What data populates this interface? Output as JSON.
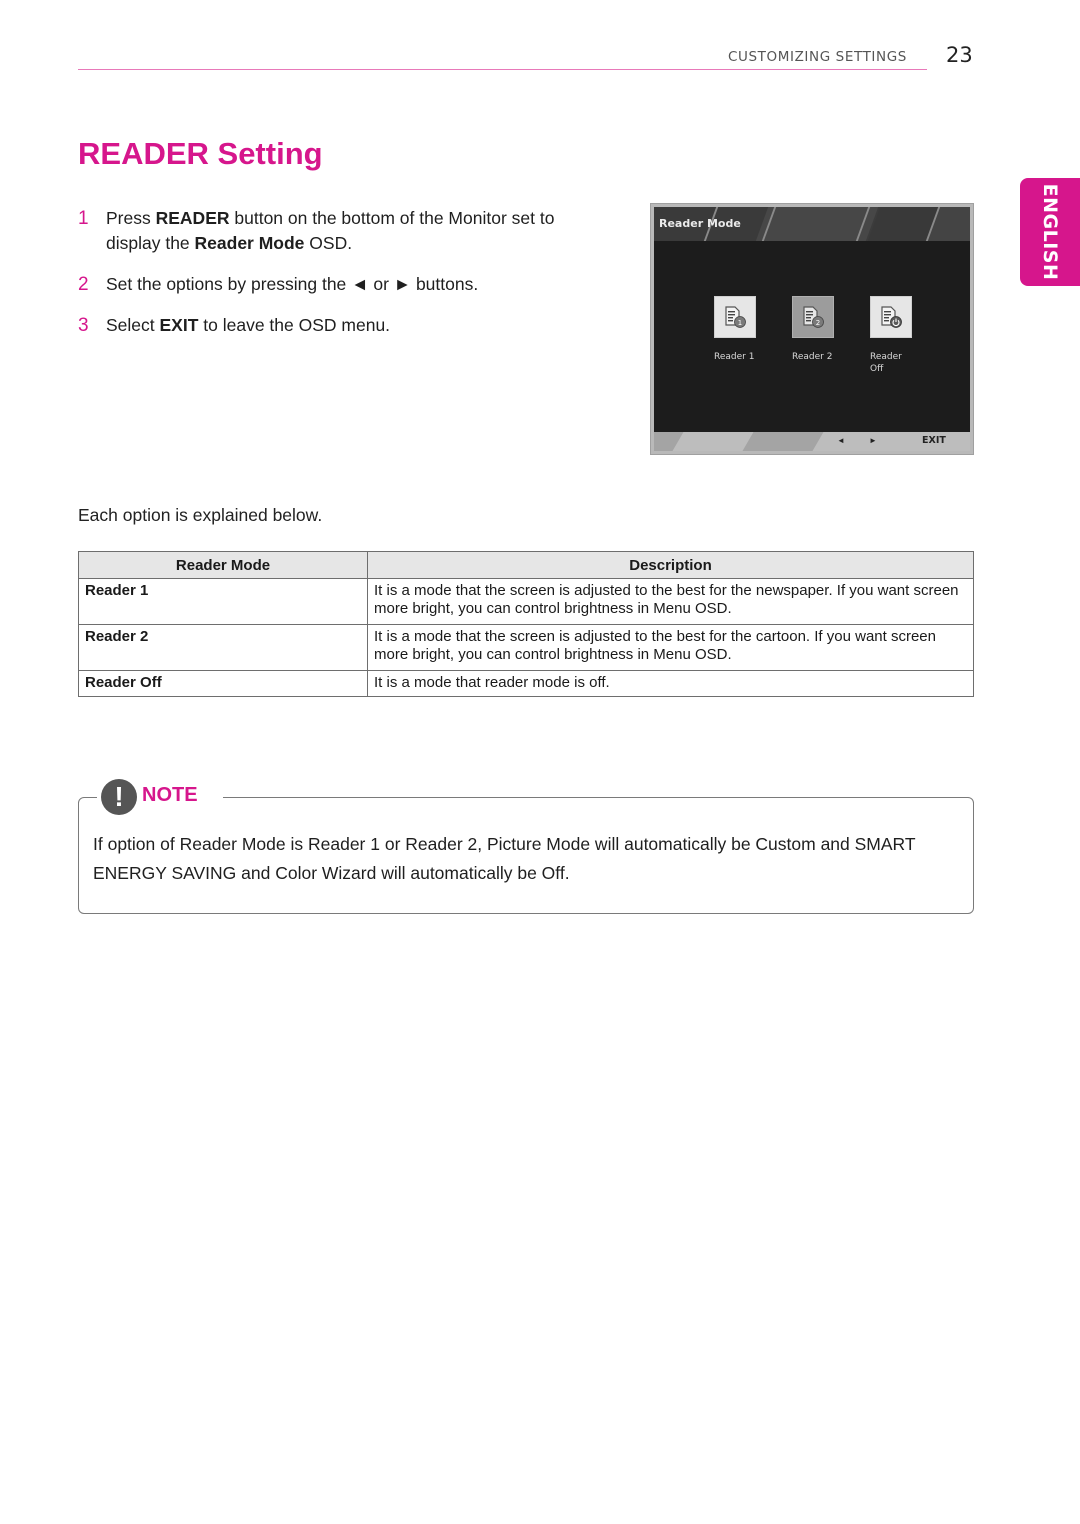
{
  "header": {
    "section_title": "CUSTOMIZING SETTINGS",
    "page_number": "23"
  },
  "language_tab": "ENGLISH",
  "title": "READER Setting",
  "steps": [
    {
      "num": "1",
      "pre": "Press ",
      "bold1": "READER",
      "mid": " button on the bottom of the Monitor set to display the ",
      "bold2": "Reader Mode",
      "post": " OSD."
    },
    {
      "num": "2",
      "text": "Set the options by pressing the ◄ or ► buttons."
    },
    {
      "num": "3",
      "pre": "Select ",
      "bold1": "EXIT",
      "post": " to leave the OSD menu."
    }
  ],
  "osd": {
    "title": "Reader Mode",
    "items": [
      {
        "label": "Reader 1",
        "badge": "1",
        "selected": false
      },
      {
        "label": "Reader 2",
        "badge": "2",
        "selected": true
      },
      {
        "label_line1": "Reader",
        "label_line2": "Off",
        "badge": "power",
        "selected": false
      }
    ],
    "left_arrow": "◄",
    "right_arrow": "►",
    "exit_label": "EXIT"
  },
  "intro": "Each option is explained below.",
  "table": {
    "headers": [
      "Reader Mode",
      "Description"
    ],
    "rows": [
      {
        "mode": "Reader 1",
        "description": "It is a mode that the screen is adjusted to the best for the newspaper. If you want screen more bright, you can control brightness in Menu OSD."
      },
      {
        "mode": "Reader 2",
        "description": "It is a mode that the screen is adjusted to the best for the cartoon. If you want screen more bright, you can control brightness in Menu OSD."
      },
      {
        "mode": "Reader Off",
        "description": "It is a mode that reader mode is off."
      }
    ]
  },
  "note": {
    "icon_glyph": "!",
    "label": "NOTE",
    "text": "If option of Reader Mode is Reader 1 or Reader 2, Picture Mode will automatically be Custom and SMART ENERGY SAVING and Color Wizard will automatically be Off."
  },
  "colors": {
    "accent": "#d6168c",
    "header_rule": "#e879b9"
  }
}
